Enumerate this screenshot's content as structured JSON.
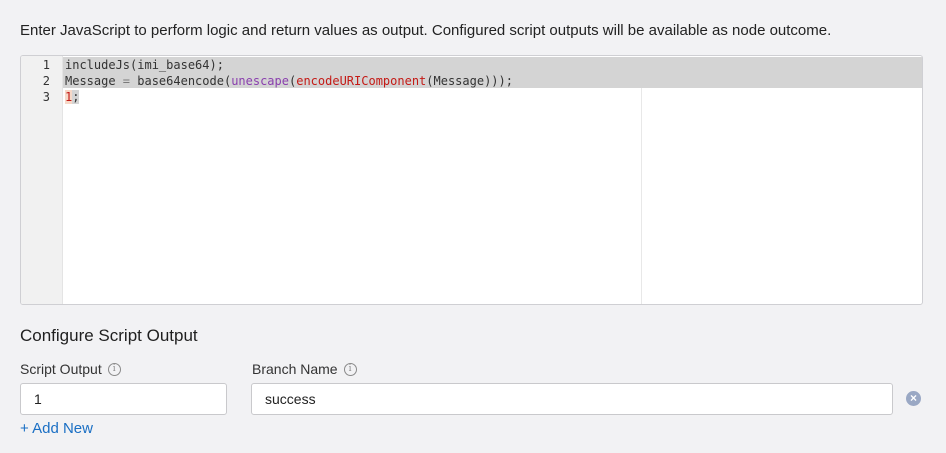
{
  "intro_text": "Enter JavaScript to perform logic and return values as output. Configured script outputs will be available as node outcome.",
  "editor": {
    "line_numbers": [
      "1",
      "2",
      "3"
    ],
    "lines": [
      [
        {
          "t": "includeJs(imi_base64);",
          "c": "plain"
        }
      ],
      [
        {
          "t": "Message ",
          "c": "plain"
        },
        {
          "t": "=",
          "c": "op"
        },
        {
          "t": " base64encode(",
          "c": "plain"
        },
        {
          "t": "unescape",
          "c": "builtin"
        },
        {
          "t": "(",
          "c": "plain"
        },
        {
          "t": "encodeURIComponent",
          "c": "fn"
        },
        {
          "t": "(Message)));",
          "c": "plain"
        }
      ],
      [
        {
          "t": "1",
          "c": "num"
        },
        {
          "t": ";",
          "c": "selend"
        }
      ]
    ]
  },
  "output_section": {
    "title": "Configure Script Output",
    "script_output_label": "Script Output",
    "branch_name_label": "Branch Name",
    "rows": [
      {
        "script_output": "1",
        "branch_name": "success"
      }
    ],
    "add_new_label": "+ Add New"
  },
  "icons": {
    "info": "info-icon",
    "remove": "remove-circle-icon"
  },
  "colors": {
    "link": "#1a6fc4",
    "background": "#f2f2f4"
  }
}
